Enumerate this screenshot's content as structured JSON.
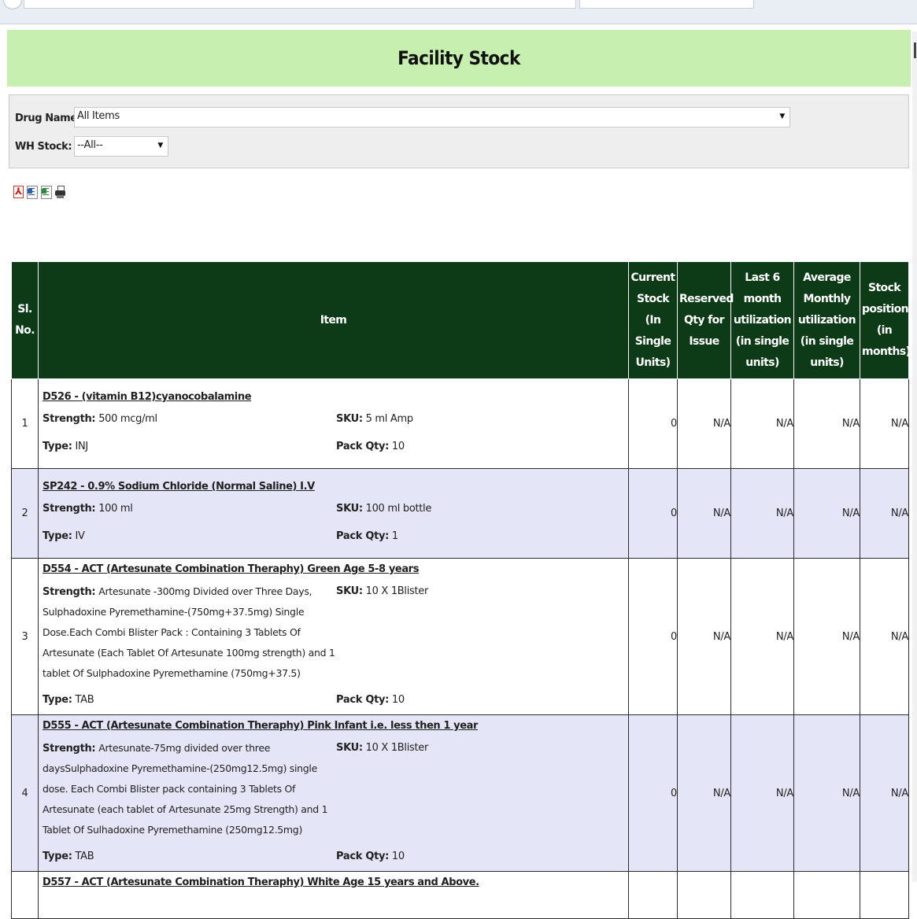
{
  "page": {
    "title": "Facility Stock"
  },
  "filters": {
    "drug_name_label": "Drug Name:",
    "drug_name_value": "All Items",
    "wh_stock_label": "WH Stock:",
    "wh_stock_value": "--All--"
  },
  "export_icons": [
    "pdf-export-icon",
    "word-export-icon",
    "excel-export-icon",
    "print-icon"
  ],
  "table": {
    "headers": {
      "sl_no": "Sl. No.",
      "item": "Item",
      "current_stock": "Current Stock (In Single Units)",
      "reserved_qty": "Reserved Qty for Issue",
      "last6": "Last 6 month utilization (in single units)",
      "avg_monthly": "Average Monthly utilization (in single units)",
      "stock_position": "Stock position (in months)"
    },
    "labels": {
      "strength": "Strength:",
      "sku": "SKU:",
      "type": "Type:",
      "pack_qty": "Pack Qty:"
    },
    "rows": [
      {
        "sl": "1",
        "name": "D526 - (vitamin B12)cyanocobalamine",
        "strength": "500 mcg/ml",
        "sku": "5 ml Amp",
        "type": "INJ",
        "pack_qty": "10",
        "current_stock": "0",
        "reserved_qty": "N/A",
        "last6": "N/A",
        "avg_monthly": "N/A",
        "stock_position": "N/A"
      },
      {
        "sl": "2",
        "name": "SP242 - 0.9% Sodium Chloride (Normal Saline) I.V",
        "strength": "100 ml",
        "sku": "100 ml bottle",
        "type": "IV",
        "pack_qty": "1",
        "current_stock": "0",
        "reserved_qty": "N/A",
        "last6": "N/A",
        "avg_monthly": "N/A",
        "stock_position": "N/A"
      },
      {
        "sl": "3",
        "name": "D554 - ACT (Artesunate Combination Theraphy) Green Age 5-8 years",
        "strength": "Artesunate -300mg Divided over Three Days, Sulphadoxine Pyremethamine-(750mg+37.5mg) Single Dose.Each Combi Blister Pack : Containing 3 Tablets Of Artesunate (Each Tablet Of Artesunate 100mg strength) and 1 tablet Of Sulphadoxine Pyremethamine (750mg+37.5)",
        "sku": "10 X 1Blister",
        "type": "TAB",
        "pack_qty": "10",
        "current_stock": "0",
        "reserved_qty": "N/A",
        "last6": "N/A",
        "avg_monthly": "N/A",
        "stock_position": "N/A"
      },
      {
        "sl": "4",
        "name": "D555 - ACT (Artesunate Combination Theraphy) Pink Infant i.e. less then 1 year",
        "strength": "Artesunate-75mg divided over three daysSulphadoxine Pyremethamine-(250mg12.5mg) single dose. Each Combi Blister pack containing 3 Tablets Of Artesunate (each tablet of Artesunate 25mg Strength) and 1 Tablet Of Sulhadoxine Pyremethamine (250mg12.5mg)",
        "sku": "10 X 1Blister",
        "type": "TAB",
        "pack_qty": "10",
        "current_stock": "0",
        "reserved_qty": "N/A",
        "last6": "N/A",
        "avg_monthly": "N/A",
        "stock_position": "N/A"
      },
      {
        "sl": "",
        "name": "D557 - ACT (Artesunate Combination Theraphy) White Age 15 years and Above."
      }
    ]
  }
}
